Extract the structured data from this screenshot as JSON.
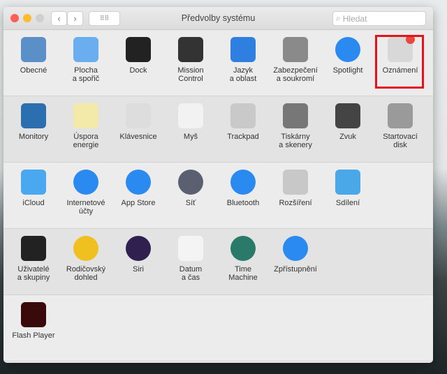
{
  "window": {
    "title": "Předvolby systému",
    "search_placeholder": "Hledat"
  },
  "rows": [
    [
      {
        "label": "Obecné",
        "icon": "general-icon",
        "color": "#5a8fc8"
      },
      {
        "label": "Plocha\na spořič",
        "icon": "desktop-icon",
        "color": "#6aaef0"
      },
      {
        "label": "Dock",
        "icon": "dock-icon",
        "color": "#222222"
      },
      {
        "label": "Mission\nControl",
        "icon": "mission-control-icon",
        "color": "#333333"
      },
      {
        "label": "Jazyk\na oblast",
        "icon": "flag-globe-icon",
        "color": "#2f7fe0"
      },
      {
        "label": "Zabezpečení\na soukromí",
        "icon": "security-house-icon",
        "color": "#8a8a8a"
      },
      {
        "label": "Spotlight",
        "icon": "spotlight-icon",
        "color": "#2a8af0"
      },
      {
        "label": "Oznámení",
        "icon": "notifications-icon",
        "color": "#d8d8d8"
      }
    ],
    [
      {
        "label": "Monitory",
        "icon": "monitor-icon",
        "color": "#2c6fb0"
      },
      {
        "label": "Úspora\nenergie",
        "icon": "bulb-icon",
        "color": "#f3e9a8"
      },
      {
        "label": "Klávesnice",
        "icon": "keyboard-icon",
        "color": "#dddddd"
      },
      {
        "label": "Myš",
        "icon": "mouse-icon",
        "color": "#f2f2f2"
      },
      {
        "label": "Trackpad",
        "icon": "trackpad-icon",
        "color": "#c9c9c9"
      },
      {
        "label": "Tiskárny\na skenery",
        "icon": "printer-icon",
        "color": "#777777"
      },
      {
        "label": "Zvuk",
        "icon": "speaker-icon",
        "color": "#444444"
      },
      {
        "label": "Startovací\ndisk",
        "icon": "disk-icon",
        "color": "#9a9a9a"
      }
    ],
    [
      {
        "label": "iCloud",
        "icon": "icloud-icon",
        "color": "#4aa8f0"
      },
      {
        "label": "Internetové\núčty",
        "icon": "at-icon",
        "color": "#2a8af0"
      },
      {
        "label": "App Store",
        "icon": "app-store-icon",
        "color": "#2a8af0"
      },
      {
        "label": "Síť",
        "icon": "network-globe-icon",
        "color": "#5a6070"
      },
      {
        "label": "Bluetooth",
        "icon": "bluetooth-icon",
        "color": "#2a8af0"
      },
      {
        "label": "Rozšíření",
        "icon": "puzzle-icon",
        "color": "#c8c8c8"
      },
      {
        "label": "Sdílení",
        "icon": "sharing-folder-icon",
        "color": "#4aa8e8"
      }
    ],
    [
      {
        "label": "Uživatelé\na skupiny",
        "icon": "users-icon",
        "color": "#222222"
      },
      {
        "label": "Rodičovský\ndohled",
        "icon": "parental-icon",
        "color": "#f0c020"
      },
      {
        "label": "Siri",
        "icon": "siri-icon",
        "color": "#302050"
      },
      {
        "label": "Datum\na čas",
        "icon": "clock-icon",
        "color": "#f4f4f4"
      },
      {
        "label": "Time\nMachine",
        "icon": "time-machine-icon",
        "color": "#2a7a6a"
      },
      {
        "label": "Zpřístupnění",
        "icon": "accessibility-icon",
        "color": "#2a8af0"
      }
    ],
    [
      {
        "label": "Flash Player",
        "icon": "flash-icon",
        "color": "#3a0a0a"
      }
    ]
  ],
  "highlight_color": "#e5141c"
}
